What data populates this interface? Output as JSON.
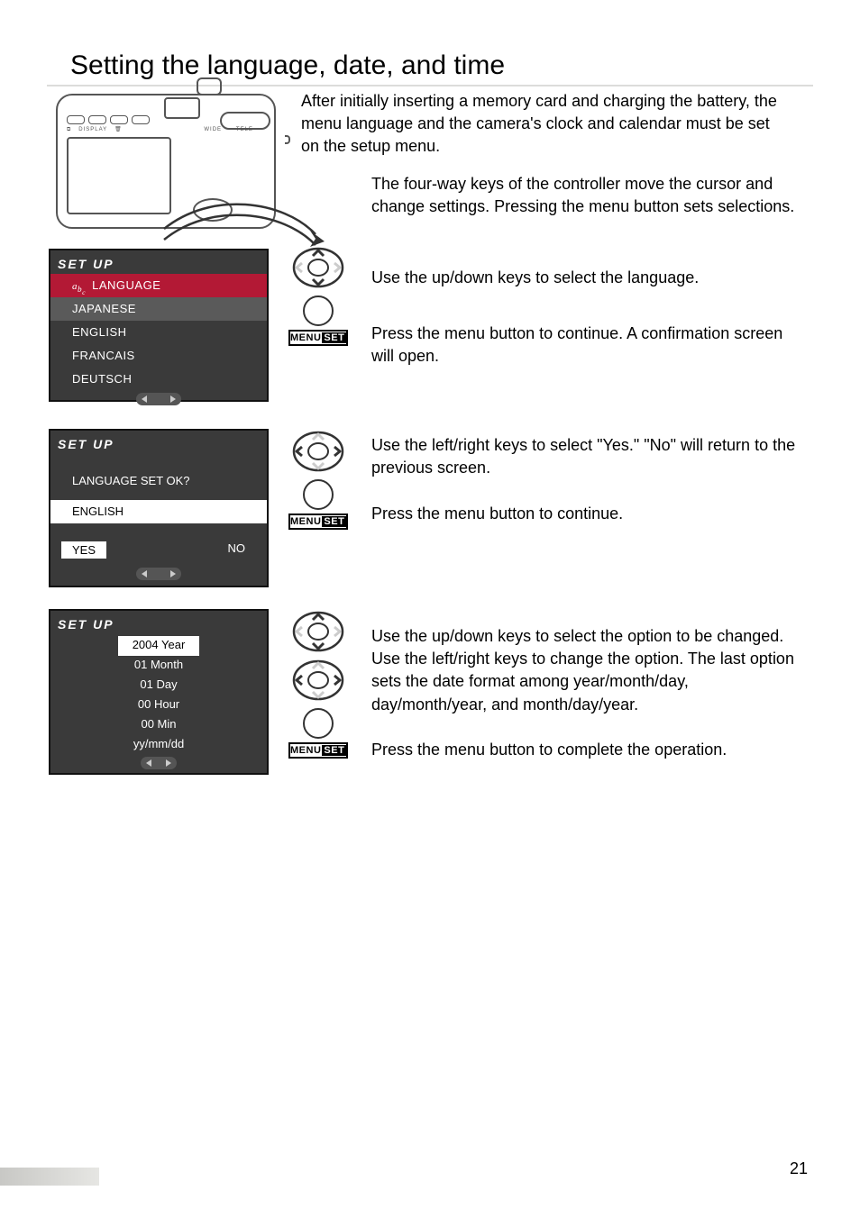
{
  "page": {
    "title": "Setting the language, date, and time",
    "number": "21"
  },
  "paragraphs": {
    "intro": "After initially inserting a memory card and charging the battery, the menu language and the camera's clock and calendar must be set on the setup menu.",
    "controller": "The four-way keys of the controller move the cursor and change settings. Pressing the menu button sets selections.",
    "step1a": "Use the up/down keys to select the language.",
    "step1b": "Press the menu button to continue. A confirmation screen will open.",
    "step2a": "Use the left/right keys to select \"Yes.\" \"No\" will return to the previous screen.",
    "step2b": "Press the menu button to continue.",
    "step3a": "Use the up/down keys to select the option to be changed. Use the left/right keys to change the option. The last option sets the date format among year/month/day, day/month/year, and month/day/year.",
    "step3b": "Press the menu button to complete the operation."
  },
  "menus": {
    "setup_label": "SET UP",
    "screen1": {
      "label_prefix": "a b c",
      "label": "LANGUAGE",
      "options": [
        "JAPANESE",
        "ENGLISH",
        "FRANCAIS",
        "DEUTSCH"
      ],
      "selected_index": 0
    },
    "screen2": {
      "prompt": "LANGUAGE SET OK?",
      "value": "ENGLISH",
      "yes": "YES",
      "no": "NO"
    },
    "screen3": {
      "rows": [
        "2004 Year",
        "01 Month",
        "01 Day",
        "00 Hour",
        "00 Min",
        "yy/mm/dd"
      ],
      "selected_index": 0
    }
  },
  "controls": {
    "menu": "MENU",
    "set": "SET"
  }
}
